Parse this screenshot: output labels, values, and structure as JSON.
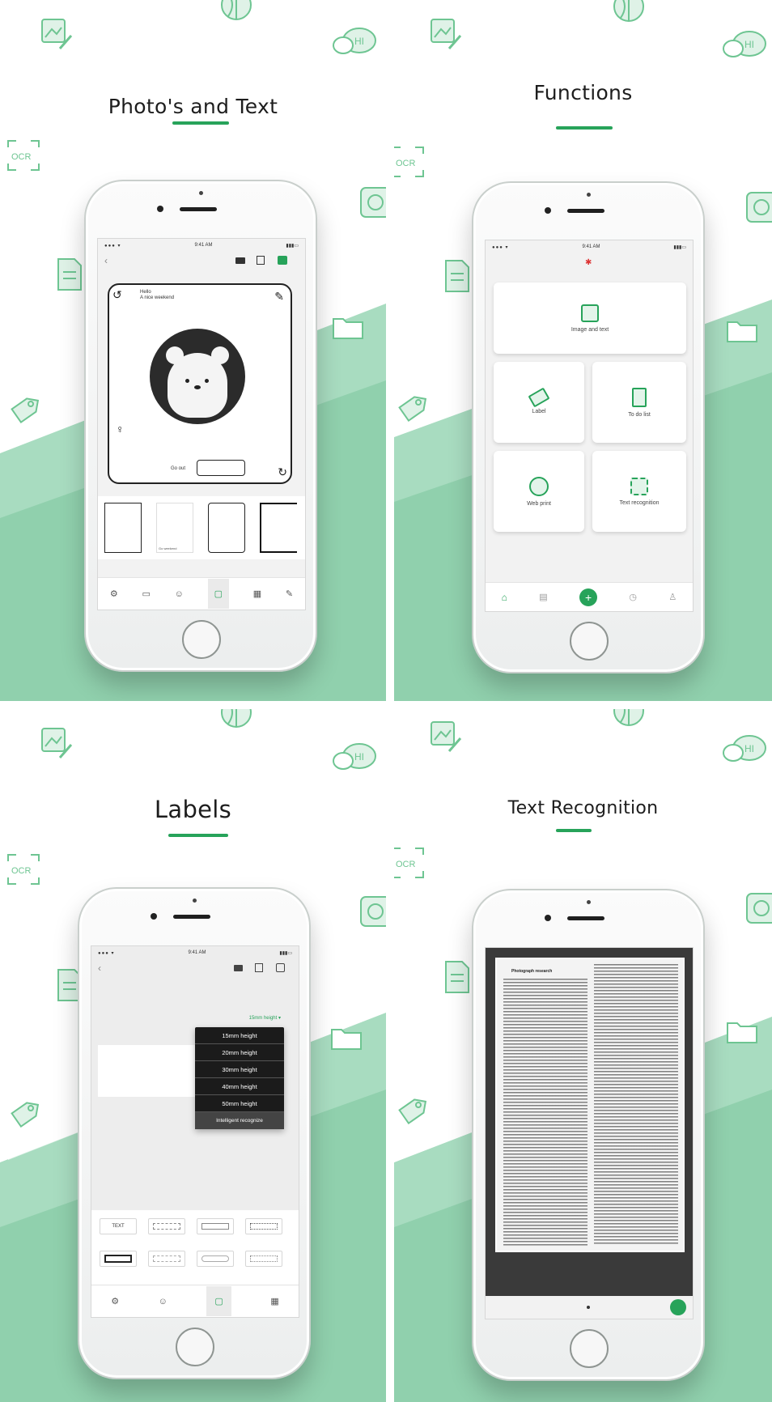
{
  "colors": {
    "accent": "#27a35a",
    "wedge_light": "#a8dcc0",
    "wedge_dark": "#6cbf90",
    "deco": "#6ec592"
  },
  "panels": {
    "photo": {
      "title": "Photo's and Text",
      "statusbar": {
        "time": "9:41 AM"
      },
      "card": {
        "caption_top_line1": "Hello",
        "caption_top_line2": "A nice weekend",
        "caption_bottom": "Go out"
      },
      "template_caption": "Go weekend",
      "toolbar_icons": [
        "settings-icon",
        "image-icon",
        "sticker-icon",
        "frame-icon",
        "qr-icon",
        "edit-icon"
      ]
    },
    "functions": {
      "title": "Functions",
      "statusbar": {
        "time": "9:41 AM"
      },
      "tiles": {
        "image_text": "Image and text",
        "label": "Label",
        "todo": "To do list",
        "web_print": "Web print",
        "text_recognition": "Text recognition"
      },
      "tab_icons": [
        "home-icon",
        "document-icon",
        "add-icon",
        "history-icon",
        "profile-icon"
      ]
    },
    "labels": {
      "title": "Labels",
      "statusbar": {
        "time": "9:41 AM"
      },
      "selector": "15mm height",
      "dropdown": [
        "15mm height",
        "20mm height",
        "30mm height",
        "40mm height",
        "50mm height",
        "Intelligent recognize"
      ],
      "chip_text": "TEXT"
    },
    "recognition": {
      "title": "Text Recognition",
      "doc_heading": "Photograph research"
    }
  }
}
